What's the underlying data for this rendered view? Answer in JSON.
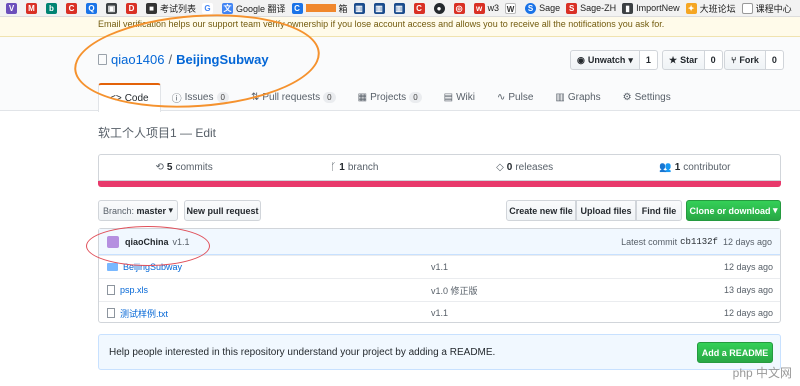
{
  "bookmarks": [
    {
      "text": "",
      "icon": "bookmark-v-icon",
      "color": "#6b4fbb"
    },
    {
      "text": "",
      "icon": "bookmark-mail-icon",
      "color": "#d93025"
    },
    {
      "text": "",
      "icon": "bookmark-b-icon",
      "color": "#008373"
    },
    {
      "text": "",
      "icon": "bookmark-c-icon",
      "color": "#d93025"
    },
    {
      "text": "",
      "icon": "bookmark-q-icon",
      "color": "#1a73e8"
    },
    {
      "text": "",
      "icon": "bookmark-game-icon",
      "color": "#3c4043"
    },
    {
      "text": "",
      "icon": "bookmark-d-icon",
      "color": "#d93025"
    },
    {
      "text": "考试列表",
      "icon": "bookmark-exam-icon",
      "color": "#333333"
    },
    {
      "text": "",
      "icon": "bookmark-g-icon",
      "color": "#4285f4"
    },
    {
      "text": "Google 翻译",
      "icon": "bookmark-translate-icon",
      "color": "#4285f4"
    },
    {
      "text": "箱",
      "icon": "bookmark-c2-icon",
      "color": "#1a73e8"
    },
    {
      "text": "",
      "icon": "bookmark-bank-icon",
      "color": "#1a4b8c"
    },
    {
      "text": "",
      "icon": "bookmark-bank2-icon",
      "color": "#1a4b8c"
    },
    {
      "text": "",
      "icon": "bookmark-bank3-icon",
      "color": "#1a4b8c"
    },
    {
      "text": "",
      "icon": "bookmark-c3-icon",
      "color": "#d93025"
    },
    {
      "text": "",
      "icon": "bookmark-github-icon",
      "color": "#24292e"
    },
    {
      "text": "",
      "icon": "bookmark-oj-icon",
      "color": "#d93025"
    },
    {
      "text": "w3",
      "icon": "bookmark-w3-icon",
      "color": "#d93025"
    },
    {
      "text": "",
      "icon": "bookmark-w-icon",
      "color": "#333333"
    },
    {
      "text": "Sage",
      "icon": "bookmark-sage-icon",
      "color": "#1a73e8"
    },
    {
      "text": "Sage-ZH",
      "icon": "bookmark-sagezh-icon",
      "color": "#d93025"
    },
    {
      "text": "ImportNew",
      "icon": "bookmark-importnew-icon",
      "color": "#3c4043"
    },
    {
      "text": "大班论坛",
      "icon": "bookmark-forum-icon",
      "color": "#f5a623"
    },
    {
      "text": "课程中心",
      "icon": "bookmark-course-icon",
      "color": "#555555"
    }
  ],
  "notice": "Email verification helps our support team verify ownership if you lose account access and allows you to receive all the notifications you ask for.",
  "repo": {
    "owner": "qiao1406",
    "sep": "/",
    "name": "BeijingSubway"
  },
  "actions": [
    {
      "label": "Unwatch",
      "icon": "eye-icon",
      "count": "1"
    },
    {
      "label": "Star",
      "icon": "star-icon",
      "count": "0"
    },
    {
      "label": "Fork",
      "icon": "fork-icon",
      "count": "0"
    }
  ],
  "tabs": [
    {
      "label": "Code",
      "icon": "code-icon",
      "badge": ""
    },
    {
      "label": "Issues",
      "icon": "issue-icon",
      "badge": "0"
    },
    {
      "label": "Pull requests",
      "icon": "pull-request-icon",
      "badge": "0"
    },
    {
      "label": "Projects",
      "icon": "project-icon",
      "badge": "0"
    },
    {
      "label": "Wiki",
      "icon": "wiki-icon",
      "badge": ""
    },
    {
      "label": "Pulse",
      "icon": "pulse-icon",
      "badge": ""
    },
    {
      "label": "Graphs",
      "icon": "graph-icon",
      "badge": ""
    },
    {
      "label": "Settings",
      "icon": "gear-icon",
      "badge": ""
    }
  ],
  "description": "软工个人项目1 — Edit",
  "summary": [
    {
      "num": "5",
      "label": "commits",
      "icon": "history-icon"
    },
    {
      "num": "1",
      "label": "branch",
      "icon": "branch-icon"
    },
    {
      "num": "0",
      "label": "releases",
      "icon": "tag-icon"
    },
    {
      "num": "1",
      "label": "contributor",
      "icon": "people-icon"
    }
  ],
  "lang_color": "#e8396b",
  "branch": {
    "prefix": "Branch:",
    "name": "master"
  },
  "buttons": {
    "new_pr": "New pull request",
    "create": "Create new file",
    "upload": "Upload files",
    "find": "Find file",
    "clone": "Clone or download"
  },
  "commit": {
    "author": "qiaoChina",
    "message": "v1.1",
    "latest_label": "Latest commit",
    "sha": "cb1132f",
    "age": "12 days ago"
  },
  "files": [
    {
      "name": "BeijingSubway",
      "type": "folder",
      "message": "v1.1",
      "age": "12 days ago"
    },
    {
      "name": "psp.xls",
      "type": "file",
      "message": "v1.0 修正版",
      "age": "13 days ago"
    },
    {
      "name": "测试样例.txt",
      "type": "file",
      "message": "v1.1",
      "age": "12 days ago"
    }
  ],
  "readme": {
    "text": "Help people interested in this repository understand your project by adding a README.",
    "button": "Add a README"
  },
  "watermark": "php 中文网"
}
